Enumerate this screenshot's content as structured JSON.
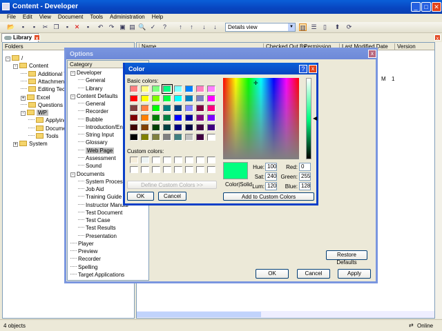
{
  "window": {
    "title": "Content - Developer"
  },
  "menu": [
    "File",
    "Edit",
    "View",
    "Document",
    "Tools",
    "Administration",
    "Help"
  ],
  "toolbar": {
    "view_select": "Details view"
  },
  "tab": {
    "label": "Library"
  },
  "folders": {
    "header": "Folders",
    "items": [
      {
        "label": "/",
        "level": 0,
        "pm": "-"
      },
      {
        "label": "Content",
        "level": 1,
        "pm": "-"
      },
      {
        "label": "Additional Top",
        "level": 2
      },
      {
        "label": "Attachments",
        "level": 2
      },
      {
        "label": "Editing Techni",
        "level": 2
      },
      {
        "label": "Excel",
        "level": 2,
        "pm": "+"
      },
      {
        "label": "Questions and",
        "level": 2
      },
      {
        "label": "WP",
        "level": 2,
        "pm": "-",
        "selected": true
      },
      {
        "label": "Applying F",
        "level": 3
      },
      {
        "label": "Document",
        "level": 3
      },
      {
        "label": "Tools",
        "level": 3
      },
      {
        "label": "System",
        "level": 1,
        "pm": "+"
      }
    ]
  },
  "list": {
    "columns": [
      "Name",
      "Checked Out By",
      "Permission",
      "Last Modified Date",
      "Version"
    ],
    "row": [
      "M",
      "1"
    ]
  },
  "options": {
    "title": "Options",
    "category_header": "Category",
    "restore_defaults": "Restore Defaults",
    "ok": "OK",
    "cancel": "Cancel",
    "apply": "Apply",
    "categories": [
      {
        "label": "Developer",
        "level": 0,
        "pm": "-"
      },
      {
        "label": "General",
        "level": 1
      },
      {
        "label": "Library",
        "level": 1
      },
      {
        "label": "Content Defaults",
        "level": 0,
        "pm": "-"
      },
      {
        "label": "General",
        "level": 1
      },
      {
        "label": "Recorder",
        "level": 1
      },
      {
        "label": "Bubble",
        "level": 1
      },
      {
        "label": "Introduction/End Fr",
        "level": 1
      },
      {
        "label": "String Input",
        "level": 1
      },
      {
        "label": "Glossary",
        "level": 1
      },
      {
        "label": "Web Page",
        "level": 1,
        "selected": true
      },
      {
        "label": "Assessment",
        "level": 1
      },
      {
        "label": "Sound",
        "level": 1
      },
      {
        "label": "Documents",
        "level": 0,
        "pm": "-"
      },
      {
        "label": "System Process",
        "level": 1
      },
      {
        "label": "Job Aid",
        "level": 1
      },
      {
        "label": "Training Guide",
        "level": 1
      },
      {
        "label": "Instructor Manual",
        "level": 1
      },
      {
        "label": "Test Document",
        "level": 1
      },
      {
        "label": "Test Case",
        "level": 1
      },
      {
        "label": "Test Results",
        "level": 1
      },
      {
        "label": "Presentation",
        "level": 1
      },
      {
        "label": "Player",
        "level": 0
      },
      {
        "label": "Preview",
        "level": 0
      },
      {
        "label": "Recorder",
        "level": 0
      },
      {
        "label": "Spelling",
        "level": 0
      },
      {
        "label": "Target Applications",
        "level": 0
      }
    ]
  },
  "color": {
    "title": "Color",
    "basic_label": "Basic colors:",
    "custom_label": "Custom colors:",
    "define_custom": "Define Custom Colors >>",
    "ok": "OK",
    "cancel": "Cancel",
    "color_solid": "Color|Solid",
    "add_custom": "Add to Custom Colors",
    "hue_label": "Hue:",
    "sat_label": "Sat:",
    "lum_label": "Lum:",
    "red_label": "Red:",
    "green_label": "Green:",
    "blue_label": "Blue:",
    "hue": "100",
    "sat": "240",
    "lum": "120",
    "red": "0",
    "green": "255",
    "blue": "128",
    "current": "#00FF80",
    "selected_index": 3,
    "basic": [
      "#FF8080",
      "#FFFF80",
      "#80FF80",
      "#00FF80",
      "#80FFFF",
      "#0080FF",
      "#FF80C0",
      "#FF80FF",
      "#FF0000",
      "#FFFF00",
      "#80FF00",
      "#00FF40",
      "#00FFFF",
      "#0080C0",
      "#8080C0",
      "#FF00FF",
      "#804040",
      "#FF8040",
      "#00FF00",
      "#008080",
      "#004080",
      "#8080FF",
      "#800040",
      "#FF0080",
      "#800000",
      "#FF8000",
      "#008000",
      "#008040",
      "#0000FF",
      "#0000A0",
      "#800080",
      "#8000FF",
      "#400000",
      "#804000",
      "#004000",
      "#004040",
      "#000080",
      "#000040",
      "#400040",
      "#400080",
      "#000000",
      "#808000",
      "#808040",
      "#808080",
      "#408080",
      "#C0C0C0",
      "#400040",
      "#FFFFFF"
    ],
    "custom": [
      "#F5EEDB",
      "#EEF4F4",
      "#FFFFFF",
      "#FFFFFF",
      "#FFFFFF",
      "#FFFFFF",
      "#FFFFFF",
      "#FFFFFF",
      "#FFFFFF",
      "#FFFFFF",
      "#FFFFFF",
      "#FFFFFF",
      "#FFFFFF",
      "#FFFFFF",
      "#FFFFFF",
      "#FFFFFF"
    ]
  },
  "status": {
    "count": "4 objects",
    "online": "Online"
  }
}
